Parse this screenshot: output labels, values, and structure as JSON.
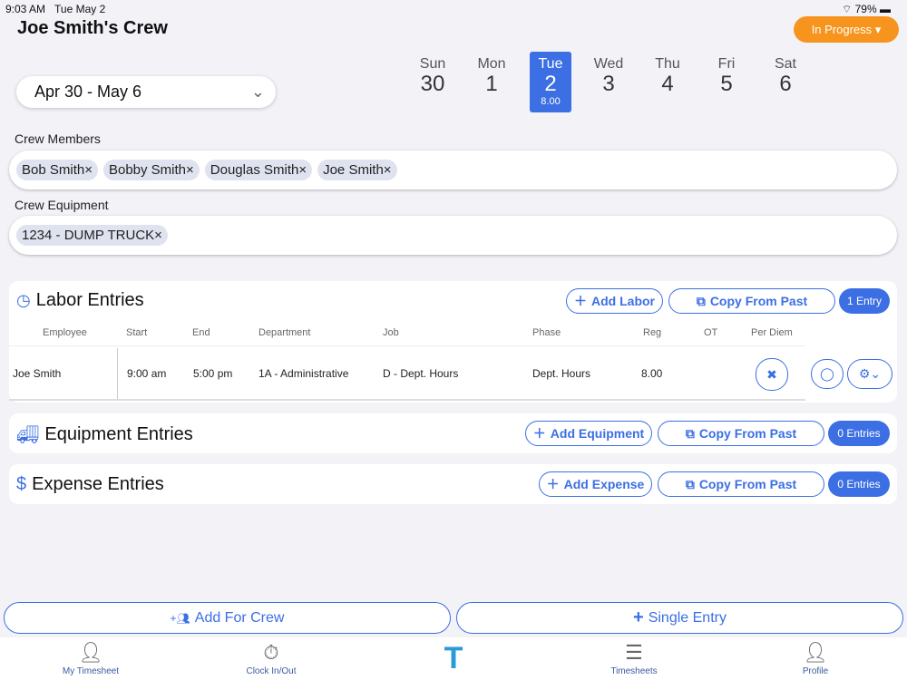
{
  "status": {
    "time": "9:03 AM",
    "date": "Tue May 2",
    "battery": "79%"
  },
  "header": {
    "title": "Joe Smith's Crew",
    "status_button": "In Progress ▾"
  },
  "week": {
    "range": "Apr 30 - May 6",
    "days": [
      {
        "name": "Sun",
        "num": "30"
      },
      {
        "name": "Mon",
        "num": "1"
      },
      {
        "name": "Tue",
        "num": "2",
        "hours": "8.00"
      },
      {
        "name": "Wed",
        "num": "3"
      },
      {
        "name": "Thu",
        "num": "4"
      },
      {
        "name": "Fri",
        "num": "5"
      },
      {
        "name": "Sat",
        "num": "6"
      }
    ]
  },
  "crew": {
    "label": "Crew Members",
    "members": [
      "Bob Smith",
      "Bobby Smith",
      "Douglas Smith",
      "Joe Smith"
    ]
  },
  "equipment_crew": {
    "label": "Crew Equipment",
    "items": [
      "1234 - DUMP TRUCK"
    ]
  },
  "labor": {
    "title": "Labor Entries",
    "add": "Add Labor",
    "copy": "Copy From Past",
    "count": "1 Entry",
    "columns": [
      "Employee",
      "Start",
      "End",
      "Department",
      "Job",
      "Phase",
      "Reg",
      "OT",
      "Per Diem"
    ],
    "rows": [
      {
        "employee": "Joe Smith",
        "start": "9:00 am",
        "end": "5:00 pm",
        "department": "1A - Administrative",
        "job": "D - Dept. Hours",
        "phase": "Dept. Hours",
        "reg": "8.00",
        "ot": ""
      }
    ]
  },
  "equipment": {
    "title": "Equipment Entries",
    "add": "Add Equipment",
    "copy": "Copy From Past",
    "count": "0 Entries"
  },
  "expense": {
    "title": "Expense Entries",
    "add": "Add Expense",
    "copy": "Copy From Past",
    "count": "0 Entries"
  },
  "bottom": {
    "crew": "Add For Crew",
    "single": "Single Entry"
  },
  "tabs": [
    "My Timesheet",
    "Clock In/Out",
    "Timesheets",
    "Profile"
  ],
  "colors": {
    "accent": "#3b6fe3",
    "orange": "#f7941d"
  }
}
